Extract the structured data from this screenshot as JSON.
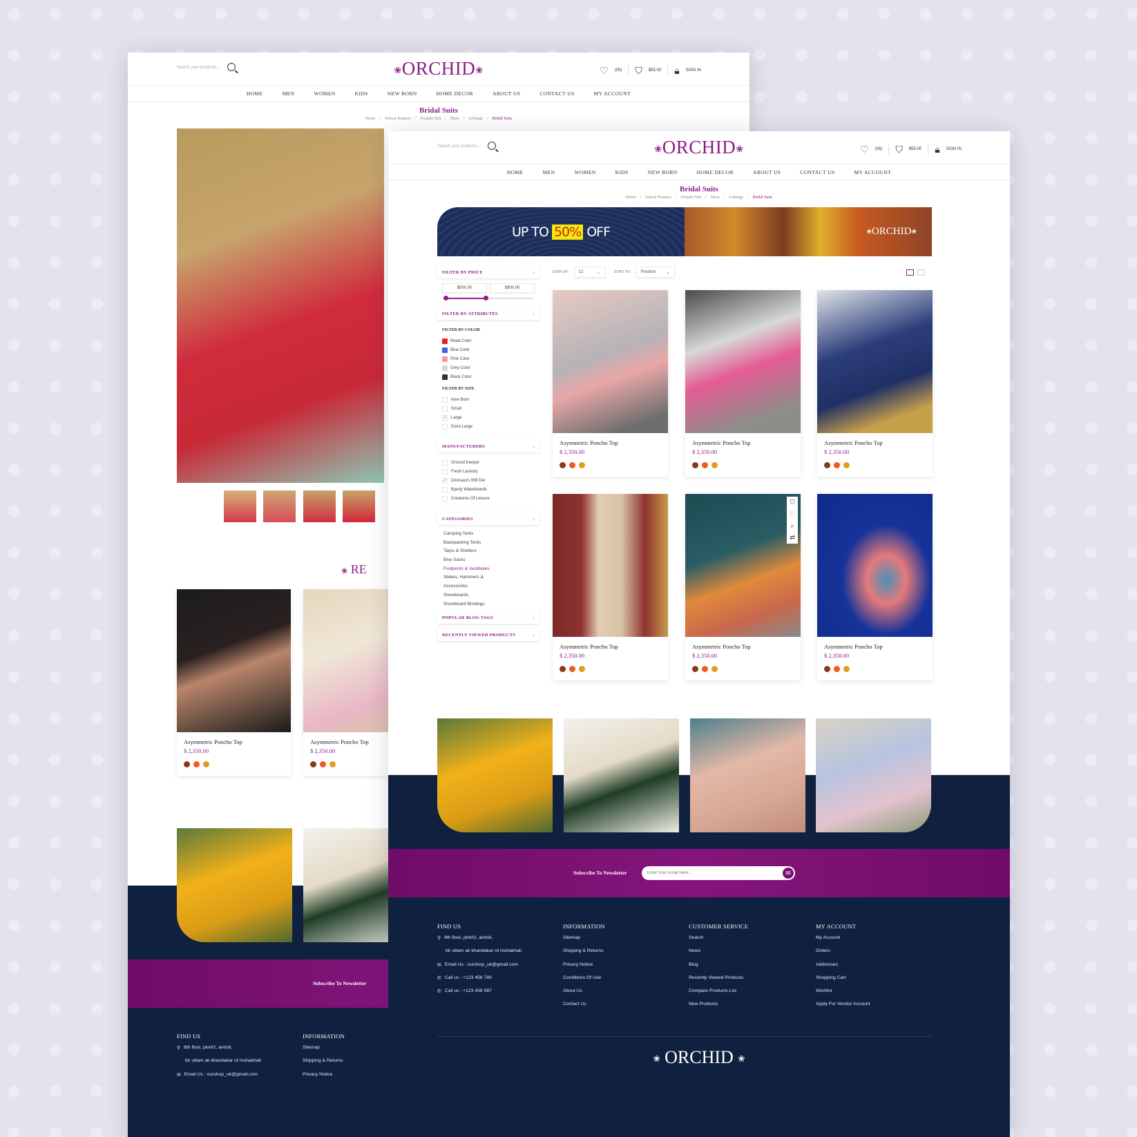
{
  "brand": {
    "logo": "ORCHID",
    "accent": "#8b1d84",
    "navy": "#0f213f",
    "band": "#7b0f72"
  },
  "header": {
    "search_placeholder": "Search your products...",
    "wishlist_count": "(05)",
    "cart_total": "$55.00",
    "sign_in": "SIGN IN"
  },
  "nav": [
    "HOME",
    "MEN",
    "WOMEN",
    "KIDS",
    "NEW BORN",
    "HOME DECOR",
    "ABOUT US",
    "CONTACT US",
    "MY ACCOUNT"
  ],
  "page": {
    "title": "Bridal Suits",
    "breadcrumb": [
      "Home",
      "Salwar Kameez",
      "Punjabi Suit",
      "Maxi",
      "Lehenga",
      "Bridal Suits"
    ]
  },
  "banner": {
    "pre": "UP TO",
    "highlight": "50%",
    "post": "OFF",
    "brand": "ORCHID"
  },
  "sidebar": {
    "price": {
      "header": "FILTER BY PRICE",
      "min": "$500.00",
      "max": "$900.00",
      "range_fraction": [
        0,
        0.45
      ]
    },
    "attributes_header": "FILTER BY ATTRIBUTES",
    "color_label": "FILTER BY COLOR",
    "colors": [
      {
        "label": "Read Color",
        "hex": "#f01d1d"
      },
      {
        "label": "Blue Color",
        "hex": "#3b66e8"
      },
      {
        "label": "Pink Color",
        "hex": "#f59a95"
      },
      {
        "label": "Grey Color",
        "hex": "#d9d9d9"
      },
      {
        "label": "Black Color",
        "hex": "#333333"
      }
    ],
    "size_label": "FILTER BY SIZE",
    "sizes": [
      {
        "label": "New Born",
        "checked": false
      },
      {
        "label": "Small",
        "checked": false
      },
      {
        "label": "Large",
        "checked": true
      },
      {
        "label": "Extra Large",
        "checked": false
      }
    ],
    "manufacturers_header": "MANUFACTURERS",
    "manufacturers": [
      {
        "label": "Ground Keeper",
        "checked": false
      },
      {
        "label": "Fresh Laundry",
        "checked": false
      },
      {
        "label": "Dinosaurs Will Die",
        "checked": true
      },
      {
        "label": "Byerly Wakeboards",
        "checked": false
      },
      {
        "label": "Creatures Of Leisure",
        "checked": false
      }
    ],
    "categories_header": "CATEGORIES",
    "categories": [
      {
        "label": "Camping Tents"
      },
      {
        "label": "Backpacking Tents"
      },
      {
        "label": "Tarps & Shelters"
      },
      {
        "label": "Bivy Sacks"
      },
      {
        "label": "Footprints & Vestibules",
        "active": true
      },
      {
        "label": "Stakes, Hammers &"
      },
      {
        "label": "Accessories"
      },
      {
        "label": "Snowboards"
      },
      {
        "label": "Snowboard Bindings"
      }
    ],
    "blog_tags_header": "POPULAR BLOG TAGS",
    "recent_header": "RECENTLY VIEWED PRODUCTS"
  },
  "toolbar": {
    "display_label": "DISPLAY :",
    "display_value": "12",
    "sort_label": "SORT BY :",
    "sort_value": "Position"
  },
  "products": [
    {
      "name": "Asymmetric Poncho Top",
      "price": "$ 2,350.00",
      "img": "linear-gradient(160deg,#e8c9c0,#b6b3b8 45%,#e9a7a8 60%,#6d6d6d 90%)"
    },
    {
      "name": "Asymmetric Poncho Top",
      "price": "$ 2,350.00",
      "img": "linear-gradient(160deg,#4a4a4a,#d7d9d6 35%,#e55c94 55%,#8d8e8a 85%)"
    },
    {
      "name": "Asymmetric Poncho Top",
      "price": "$ 2,350.00",
      "img": "linear-gradient(160deg,#dfe4ea,#2c3e7a 40%,#203066 65%,#c7a04a 85%)"
    },
    {
      "name": "Asymmetric Poncho Top",
      "price": "$ 2,350.00",
      "img": "linear-gradient(90deg,#7a2a26,#8e3230 25%,#e1cdb2 40%,#d8c1a4 60%,#8e3230 80%,#c79a4b)"
    },
    {
      "name": "Asymmetric Poncho Top",
      "price": "$ 2,350.00",
      "img": "linear-gradient(160deg,#1d4b52,#2a5d64 40%,#e08a3c 60%,#c9674d 80%,#8a8a8a)",
      "hover_icons": [
        "bag",
        "heart",
        "search",
        "shuffle"
      ]
    },
    {
      "name": "Asymmetric Poncho Top",
      "price": "$ 2,350.00",
      "img": "radial-gradient(ellipse at 60% 60%,#4d8fb5,#e47a7a 20%,#17339a 45%,#0d2a8a)"
    }
  ],
  "swatches": [
    "#8a3a14",
    "#f05a24",
    "#e59a22"
  ],
  "gallery": [
    "linear-gradient(160deg,#5a7a3a,#f2b11a 40%,#d99c16 70%,#4e6a2f)",
    "linear-gradient(160deg,#f3f1ec,#e4dbc7 40%,#1f3d26 60%,#f0ede5)",
    "linear-gradient(160deg,#4e7f8c,#e3b8a8 40%,#d7a894 70%,#c28d7d)",
    "linear-gradient(160deg,#d9d3c5,#b7c4df 40%,#e4c3cf 70%,#8d9a7a)"
  ],
  "newsletter": {
    "label": "Subscribe To Newsletter",
    "placeholder": "Enter Your Email Here..."
  },
  "footer": {
    "find_us": {
      "title": "FIND US",
      "lines": [
        "8th floor, plot#2, amtoli,",
        "bir uttam ak khandakar rd mohakhali",
        "Email Us : ourshop_uk@gmail.com",
        "Call us : +123 456 789",
        "Call us : +123 456 987"
      ]
    },
    "information": {
      "title": "INFORMATION",
      "links": [
        "Sitemap",
        "Shipping & Returns",
        "Privacy Notice",
        "Conditions Of Use",
        "About Us",
        "Contact Us"
      ]
    },
    "customer_service": {
      "title": "CUSTOMER SERVICE",
      "links": [
        "Search",
        "News",
        "Blog",
        "Recently Viewed Products",
        "Compare Products List",
        "New Products"
      ]
    },
    "my_account": {
      "title": "MY ACCOUNT",
      "links": [
        "My Account",
        "Orders",
        "Addresses",
        "Shopping Cart",
        "Wishlist",
        "Apply For Vendor Account"
      ]
    }
  },
  "back_page": {
    "hero_img": "linear-gradient(160deg,#b89a5e,#c7a46c 30%,#d02b3c 55%,#c72a37 75%,#8fc7b4)",
    "thumbs": [
      "linear-gradient(#d7b27c,#d43a4c)",
      "linear-gradient(#cfa874,#d84a5a)",
      "linear-gradient(#c6a06a,#cf2f3f)",
      "linear-gradient(#c7a56d,#d3263a)"
    ],
    "related_heading": "RE",
    "cards": [
      {
        "name": "Asymmetric Poncho Top",
        "price": "$ 2,350.00",
        "img": "linear-gradient(160deg,#1c1c1c,#2a2020 40%,#b9856a 55%,#1a1a1a)"
      },
      {
        "name": "Asymmetric Poncho Top",
        "price": "$ 2,350.00",
        "img": "linear-gradient(160deg,#e6d7bd,#efe7d6 40%,#e9b8c6 75%,#d7c7a5)"
      }
    ]
  }
}
